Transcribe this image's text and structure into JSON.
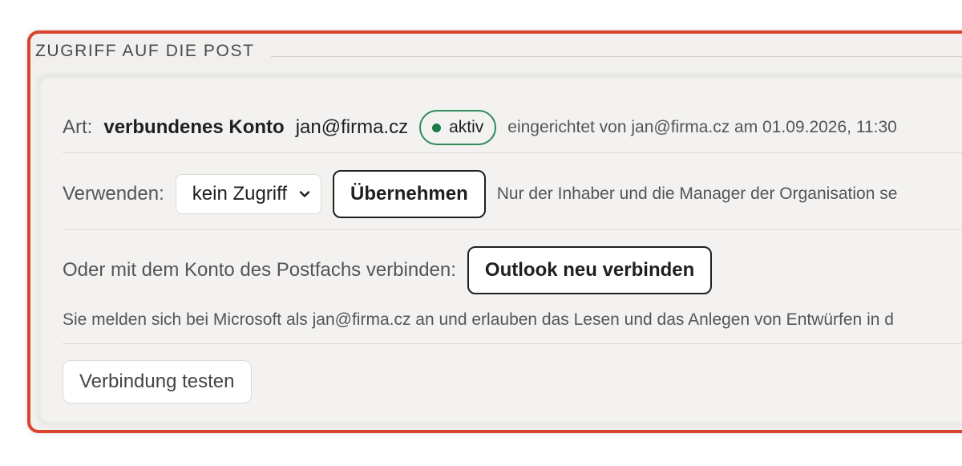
{
  "section": {
    "title": "ZUGRIFF AUF DIE POST"
  },
  "account_row": {
    "type_label": "Art:",
    "type_value": "verbundenes Konto",
    "email": "jan@firma.cz",
    "status_badge": "aktiv",
    "status_color": "#2f8a5a",
    "setup_info": "eingerichtet von jan@firma.cz am 01.09.2026, 11:30"
  },
  "use_row": {
    "label": "Verwenden:",
    "select_value": "kein Zugriff",
    "apply_button": "Übernehmen",
    "hint": "Nur der Inhaber und die Manager der Organisation se"
  },
  "connect_row": {
    "label": "Oder mit dem Konto des Postfachs verbinden:",
    "reconnect_button": "Outlook neu verbinden",
    "note": "Sie melden sich bei Microsoft als jan@firma.cz an und erlauben das Lesen und das Anlegen von Entwürfen in d"
  },
  "test_row": {
    "test_button": "Verbindung testen"
  },
  "colors": {
    "frame_border": "#d9442f",
    "panel_background": "#f3f2f0"
  }
}
